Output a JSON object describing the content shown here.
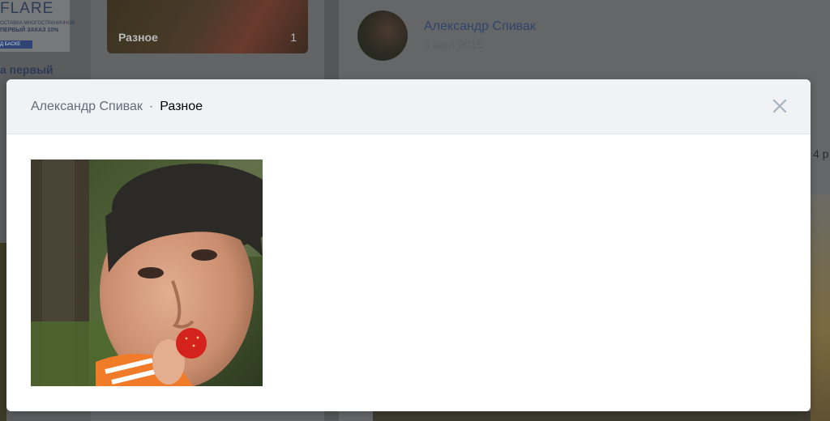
{
  "background": {
    "ad": {
      "logo": "FLARE",
      "line1": "ОСТАВКА МНОГОСТРАНИЧНОЙ",
      "line2": "ПЕРВЫЙ ЗАКАЗ 10%",
      "button": "Д БАСКЕ",
      "title": "а первый"
    },
    "album": {
      "name": "Разное",
      "count": "1"
    },
    "post": {
      "author": "Александр Спивак",
      "date": "5 июн 2015"
    },
    "edge_text": "4 р"
  },
  "modal": {
    "breadcrumb": {
      "author": "Александр Спивак",
      "separator": "·",
      "album": "Разное"
    },
    "close_icon": "close-icon",
    "photo": {
      "description_icon": "photo"
    }
  },
  "colors": {
    "overlay": "#545658",
    "header_bg": "#f0f2f5",
    "link": "#626d7a",
    "close": "#a8b3bf"
  }
}
